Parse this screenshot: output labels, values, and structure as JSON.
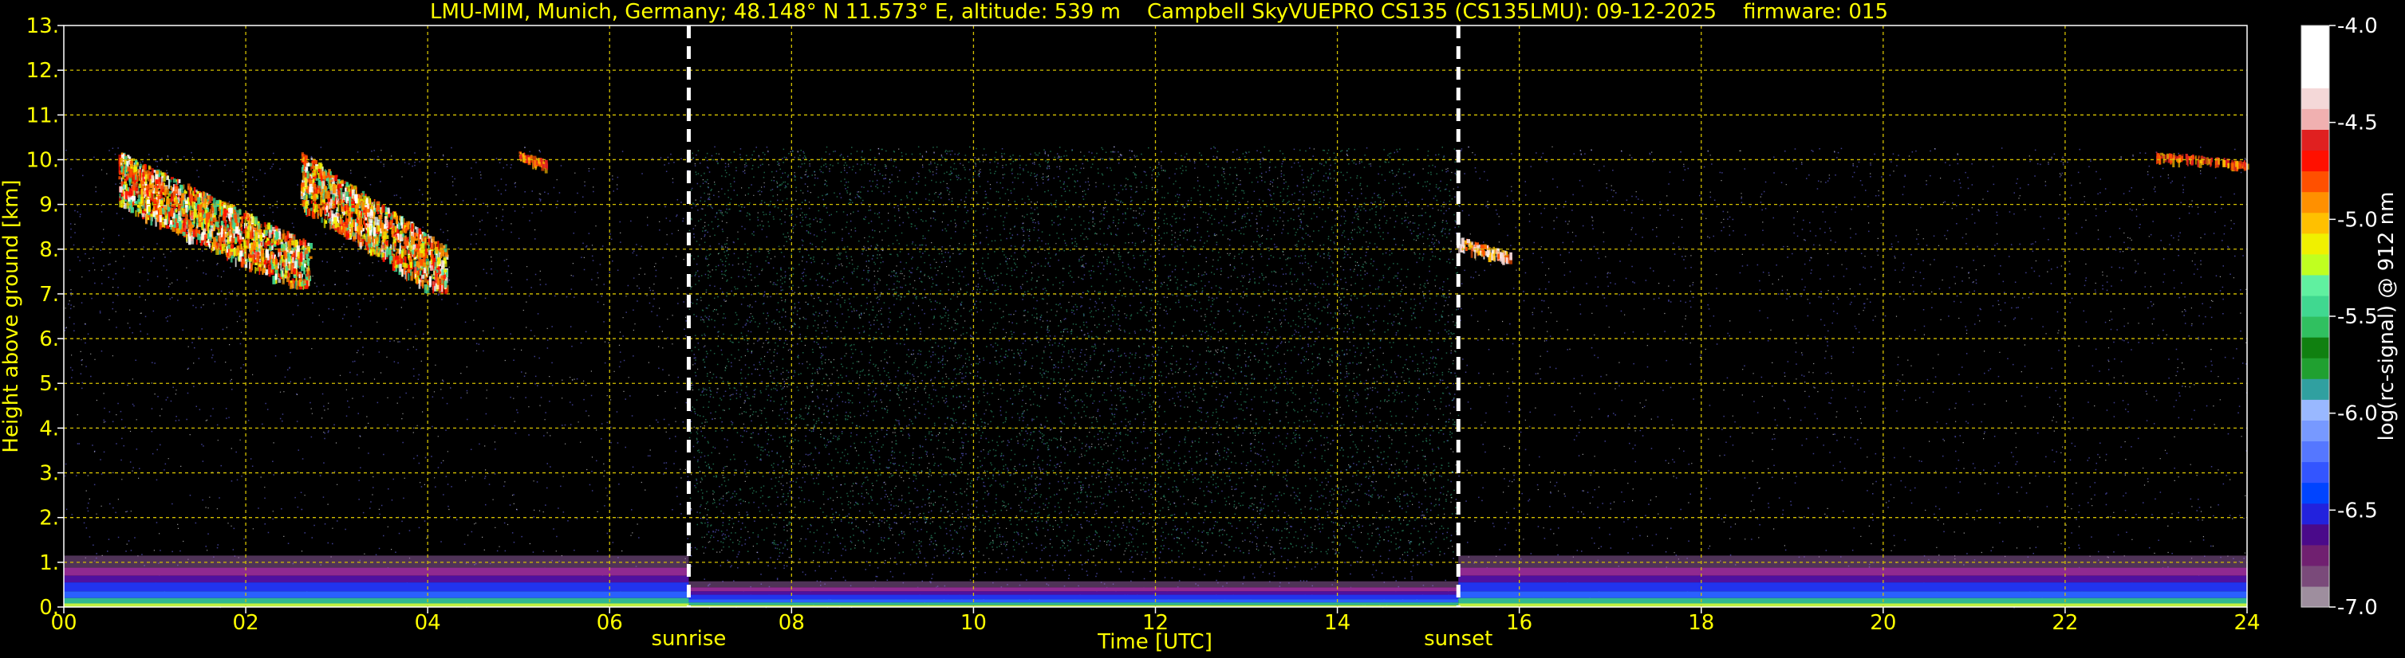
{
  "chart_data": {
    "type": "heatmap",
    "title": "LMU-MIM, Munich, Germany; 48.148° N 11.573° E, altitude: 539 m    Campbell SkyVUEPRO CS135 (CS135LMU): 09-12-2025    firmware: 015",
    "xlabel": "Time [UTC]",
    "ylabel": "Height above ground [km]",
    "xlim": [
      0,
      24
    ],
    "ylim": [
      0,
      13
    ],
    "x_ticks": [
      0,
      2,
      4,
      6,
      8,
      10,
      12,
      14,
      16,
      18,
      20,
      22,
      24
    ],
    "x_tick_labels": [
      "00",
      "02",
      "04",
      "06",
      "08",
      "10",
      "12",
      "14",
      "16",
      "18",
      "20",
      "22",
      "24"
    ],
    "y_ticks": [
      0,
      1,
      2,
      3,
      4,
      5,
      6,
      7,
      8,
      9,
      10,
      11,
      12,
      13
    ],
    "y_tick_labels": [
      "0.",
      "1.",
      "2.",
      "3.",
      "4.",
      "5.",
      "6.",
      "7.",
      "8.",
      "9.",
      "10.",
      "11.",
      "12.",
      "13."
    ],
    "grid": true,
    "measurement_top_km": 10.3,
    "markers": [
      {
        "label": "sunrise",
        "time": 6.87
      },
      {
        "label": "sunset",
        "time": 15.33
      }
    ],
    "colorbar": {
      "label": "log(rc-signal) @ 912 nm",
      "range": [
        -7.0,
        -4.0
      ],
      "ticks": [
        -4.0,
        -4.5,
        -5.0,
        -5.5,
        -6.0,
        -6.5,
        -7.0
      ],
      "tick_labels": [
        "-4.0",
        "-4.5",
        "-5.0",
        "-5.5",
        "-6.0",
        "-6.5",
        "-7.0"
      ],
      "colors": [
        "#9e8e9e",
        "#7a4a7a",
        "#702070",
        "#4a0a8a",
        "#2222dd",
        "#0044ff",
        "#3355ff",
        "#5577ff",
        "#7799ff",
        "#99b8ff",
        "#30a0a0",
        "#20a030",
        "#108010",
        "#30c060",
        "#40d890",
        "#60f0a0",
        "#c0ff20",
        "#f0f000",
        "#ffc000",
        "#ff9000",
        "#ff5000",
        "#ff1000",
        "#e02020",
        "#f0b0b0",
        "#f4d8d8",
        "#ffffff",
        "#ffffff",
        "#ffffff"
      ]
    },
    "clouds": [
      {
        "t_start": 0.6,
        "t_end": 2.7,
        "h_low": 7.3,
        "h_high": 10.2,
        "intensity": "high"
      },
      {
        "t_start": 2.6,
        "t_end": 4.2,
        "h_low": 7.2,
        "h_high": 10.2,
        "intensity": "high"
      },
      {
        "t_start": 5.0,
        "t_end": 5.3,
        "h_low": 9.9,
        "h_high": 10.2,
        "intensity": "medium"
      },
      {
        "t_start": 15.3,
        "t_end": 15.9,
        "h_low": 7.8,
        "h_high": 8.3,
        "intensity": "very-high"
      },
      {
        "t_start": 23.0,
        "t_end": 24.0,
        "h_low": 9.9,
        "h_high": 10.2,
        "intensity": "medium"
      }
    ],
    "boundary_layer": {
      "night_top_km": 0.9,
      "day_top_km": 0.45
    }
  }
}
